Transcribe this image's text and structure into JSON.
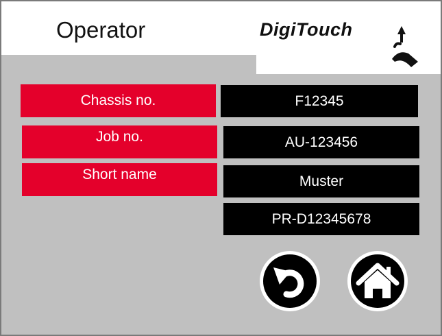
{
  "header": {
    "title": "Operator",
    "logo_text": "DigiTouch"
  },
  "fields": [
    {
      "label": "Chassis no.",
      "value": "F12345"
    },
    {
      "label": "Job no.",
      "value": "AU-123456"
    },
    {
      "label": "Short name",
      "value": "Muster"
    }
  ],
  "extra_value": "PR-D12345678",
  "buttons": {
    "back_icon": "undo-arrow-icon",
    "home_icon": "home-icon"
  },
  "colors": {
    "label_bg": "#e4002b",
    "value_bg": "#000000",
    "panel_bg": "#c0c0c0"
  }
}
